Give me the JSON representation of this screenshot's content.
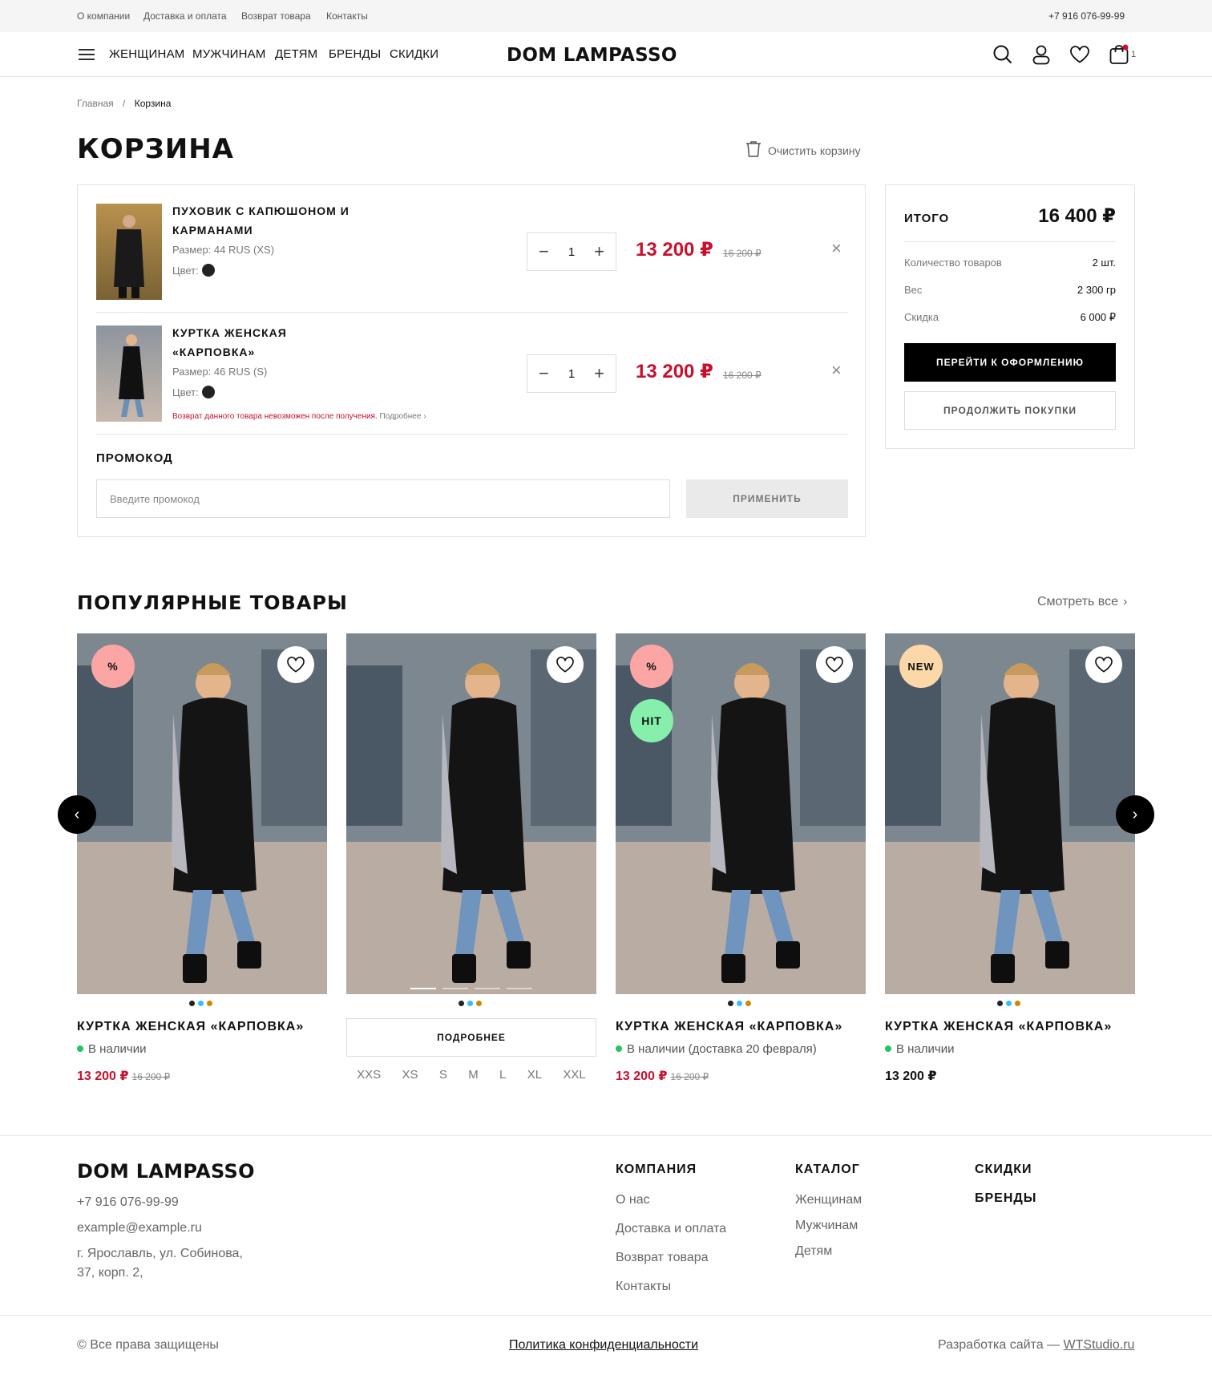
{
  "topbar": {
    "links": [
      "О компании",
      "Доставка и оплата",
      "Возврат товара",
      "Контакты"
    ],
    "phone": "+7 916 076-99-99"
  },
  "header": {
    "nav": [
      "ЖЕНЩИНАМ",
      "МУЖЧИНАМ",
      "ДЕТЯМ",
      "БРЕНДЫ",
      "СКИДКИ"
    ],
    "logo": "DOM LAMPASSO",
    "cart_count": "1",
    "icons": [
      "menu-icon",
      "search-icon",
      "user-icon",
      "heart-icon",
      "cart-icon"
    ]
  },
  "breadcrumb": {
    "home": "Главная",
    "sep": "/",
    "current": "Корзина"
  },
  "page": {
    "title": "КОРЗИНА",
    "clear_cart": "Очистить корзину"
  },
  "cart": {
    "items": [
      {
        "name": "ПУХОВИК С КАПЮШОНОМ И КАРМАНАМИ",
        "size": "Размер: 44 RUS (XS)",
        "color_label": "Цвет:",
        "qty": "1",
        "price": "13 200 ₽",
        "old_price": "16 200 ₽"
      },
      {
        "name": "КУРТКА ЖЕНСКАЯ «КАРПОВКА»",
        "size": "Размер: 46 RUS (S)",
        "color_label": "Цвет:",
        "qty": "1",
        "price": "13 200 ₽",
        "old_price": "16 200 ₽",
        "return_note": "Возврат данного товара невозможен после получения.",
        "return_more": "Подробнее"
      }
    ],
    "promo": {
      "label": "ПРОМОКОД",
      "placeholder": "Введите промокод",
      "apply": "ПРИМЕНИТЬ"
    }
  },
  "summary": {
    "title": "ИТОГО",
    "total": "16 400 ₽",
    "rows": [
      {
        "label": "Количество товаров",
        "value": "2 шт."
      },
      {
        "label": "Вес",
        "value": "2 300 гр"
      },
      {
        "label": "Скидка",
        "value": "6 000 ₽"
      }
    ],
    "checkout": "ПЕРЕЙТИ К ОФОРМЛЕНИЮ",
    "continue": "ПРОДОЛЖИТЬ ПОКУПКИ"
  },
  "popular": {
    "title": "ПОПУЛЯРНЫЕ ТОВАРЫ",
    "see_all": "Смотреть все",
    "cards": [
      {
        "badges": [
          "%"
        ],
        "name": "КУРТКА ЖЕНСКАЯ «КАРПОВКА»",
        "stock": "В наличии",
        "price": "13 200 ₽",
        "old_price": "16 200 ₽"
      },
      {
        "badges": [],
        "more": "ПОДРОБНЕЕ",
        "sizes": [
          "XXS",
          "XS",
          "S",
          "M",
          "L",
          "XL",
          "XXL"
        ]
      },
      {
        "badges": [
          "%",
          "HIT"
        ],
        "name": "КУРТКА ЖЕНСКАЯ «КАРПОВКА»",
        "stock": "В наличии (доставка 20 февраля)",
        "price": "13 200 ₽",
        "old_price": "16 200 ₽"
      },
      {
        "badges": [
          "NEW"
        ],
        "name": "КУРТКА ЖЕНСКАЯ «КАРПОВКА»",
        "stock": "В наличии",
        "price": "13 200 ₽"
      }
    ],
    "colors": {
      "badge_sale": "#fca5a5",
      "badge_hit": "#86efac",
      "badge_new": "#fcd7a8",
      "swatch": [
        "#222222",
        "#38bdf8",
        "#ca8a04"
      ]
    }
  },
  "footer": {
    "logo": "DOM LAMPASSO",
    "phone": "+7 916 076-99-99",
    "email": "example@example.ru",
    "address_1": "г. Ярославль, ул. Собинова,",
    "address_2": "37, корп. 2,",
    "company": {
      "title": "КОМПАНИЯ",
      "links": [
        "О нас",
        "Доставка и оплата",
        "Возврат товара",
        "Контакты"
      ]
    },
    "catalog": {
      "title": "КАТАЛОГ",
      "links": [
        "Женщинам",
        "Мужчинам",
        "Детям"
      ]
    },
    "discounts": "СКИДКИ",
    "brands": "БРЕНДЫ",
    "copyright": "© Все права защищены",
    "privacy": "Политика конфиденциальности",
    "dev_label": "Разработка сайта —",
    "dev_link": "WTStudio.ru"
  },
  "theme": {
    "accent": "#c8102e",
    "dark": "#000000"
  }
}
